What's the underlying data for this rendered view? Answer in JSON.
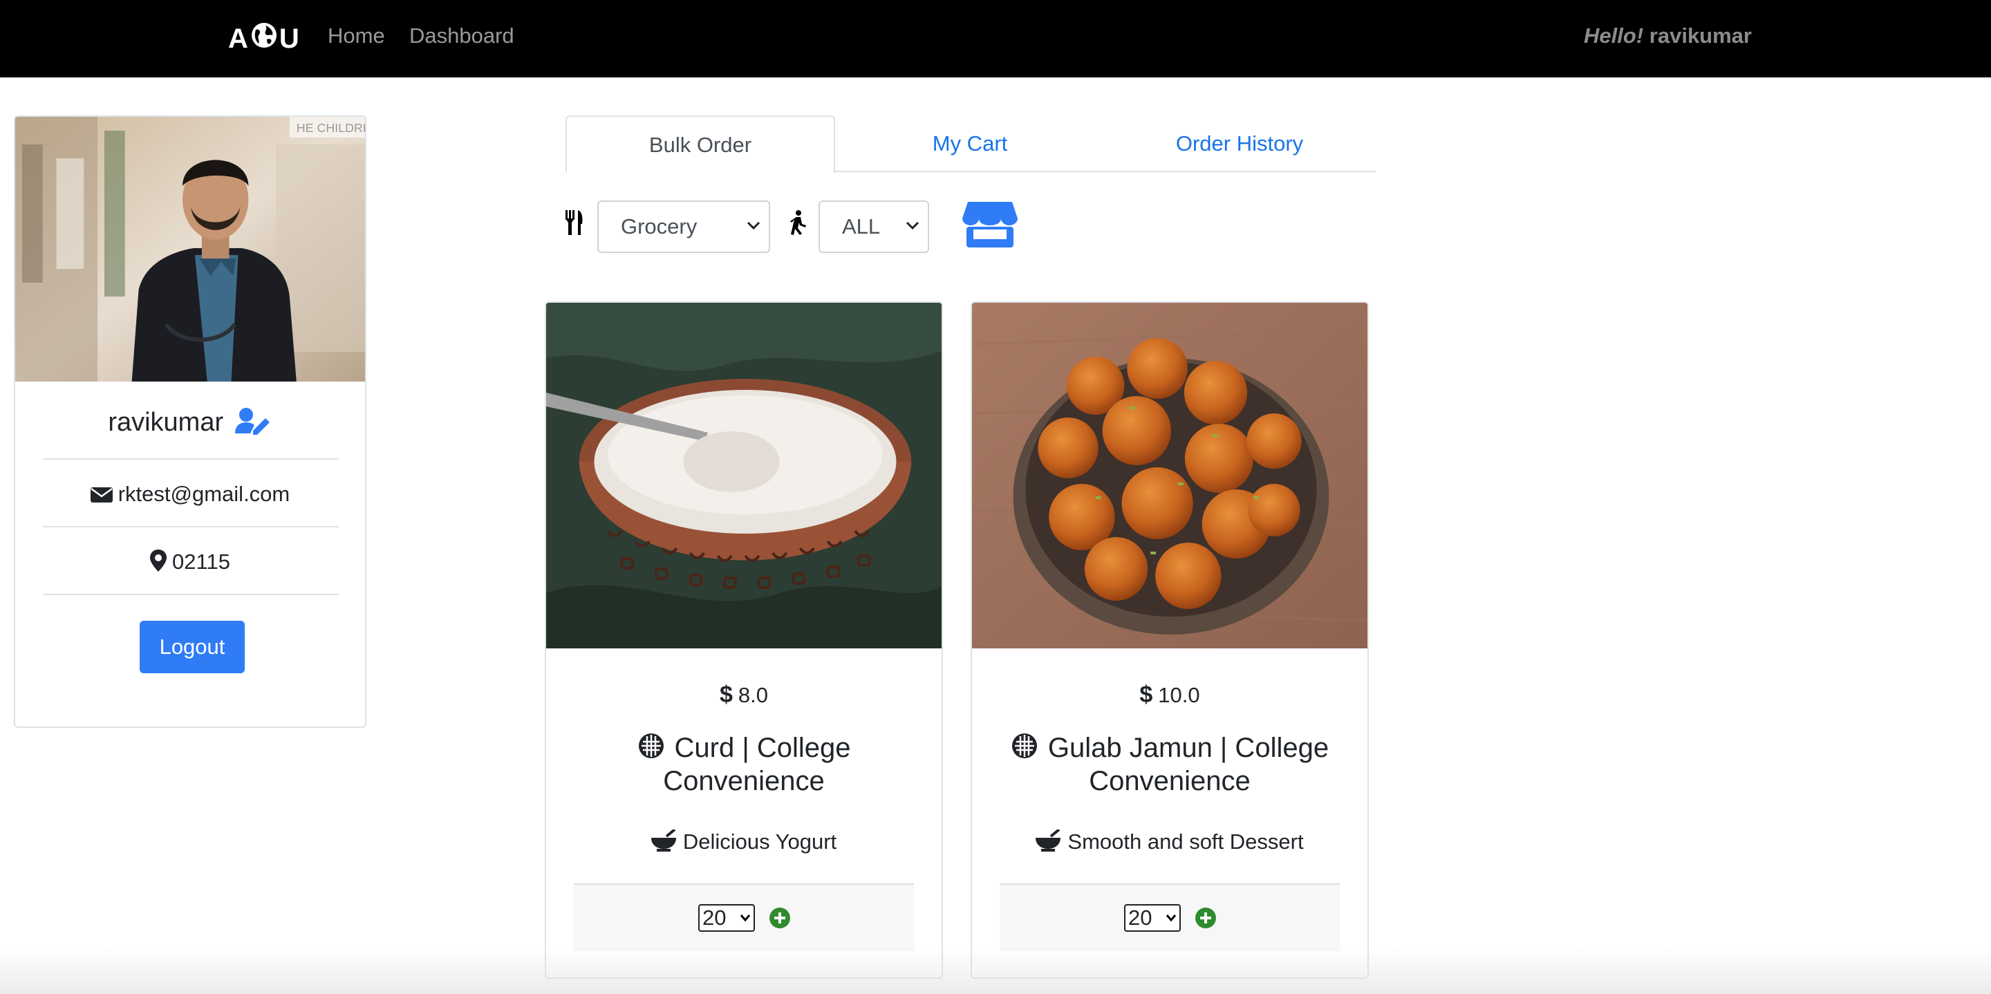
{
  "nav": {
    "brand_a": "A",
    "brand_u": "U",
    "home": "Home",
    "dashboard": "Dashboard",
    "hello": "Hello!",
    "username": "ravikumar"
  },
  "profile": {
    "name": "ravikumar",
    "email": "rktest@gmail.com",
    "zip": "02115",
    "logout_label": "Logout",
    "photo_watermark": "HE CHILDRE"
  },
  "tabs": [
    {
      "label": "Bulk Order",
      "active": true
    },
    {
      "label": "My Cart",
      "active": false
    },
    {
      "label": "Order History",
      "active": false
    }
  ],
  "filters": {
    "category_selected": "Grocery",
    "type_selected": "ALL"
  },
  "products": [
    {
      "price_symbol": "$",
      "price": "8.0",
      "title": "Curd | College Convenience",
      "description": "Delicious Yogurt",
      "quantity": "20"
    },
    {
      "price_symbol": "$",
      "price": "10.0",
      "title": "Gulab Jamun | College Convenience",
      "description": "Smooth and soft Dessert",
      "quantity": "20"
    }
  ],
  "colors": {
    "navbar": "#000000",
    "primary": "#2f7cf6",
    "link": "#1a73e8",
    "add": "#2e8b2e"
  },
  "icons": [
    "globe-icon",
    "user-edit-icon",
    "envelope-icon",
    "map-marker-icon",
    "utensils-icon",
    "walking-icon",
    "store-icon",
    "veg-icon",
    "bowl-icon",
    "plus-circle-icon",
    "chevron-down-icon"
  ]
}
